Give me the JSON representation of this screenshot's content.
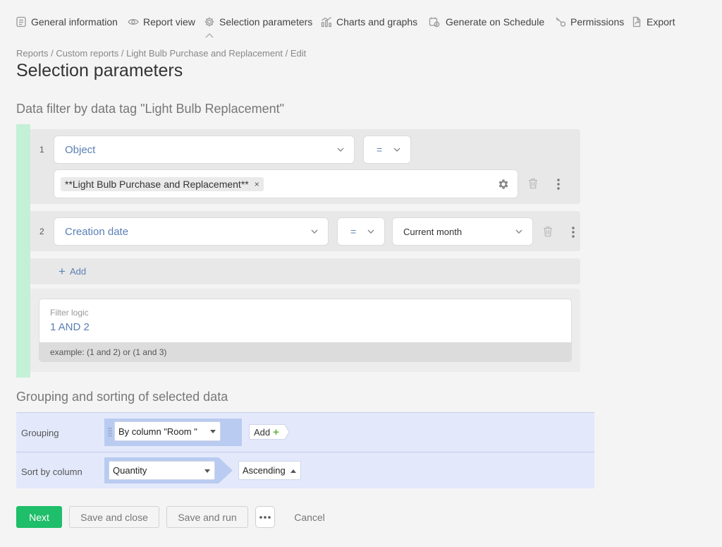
{
  "tabs": [
    {
      "label": "General information",
      "icon": "document-icon"
    },
    {
      "label": "Report view",
      "icon": "eye-icon"
    },
    {
      "label": "Selection parameters",
      "icon": "gear-icon",
      "active": true
    },
    {
      "label": "Charts and graphs",
      "icon": "chart-icon"
    },
    {
      "label": "Generate on Schedule",
      "icon": "calendar-clock-icon"
    },
    {
      "label": "Permissions",
      "icon": "key-icon"
    },
    {
      "label": "Export",
      "icon": "export-icon"
    }
  ],
  "breadcrumb": [
    "Reports",
    "Custom reports",
    "Light Bulb Purchase and Replacement",
    "Edit"
  ],
  "breadcrumb_sep": " / ",
  "page_title": "Selection parameters",
  "filter_section": {
    "title": "Data filter by data tag \"Light Bulb Replacement\"",
    "rows": [
      {
        "num": "1",
        "field": "Object",
        "operator": "=",
        "tag": "**Light Bulb Purchase and Replacement**",
        "tag_remove": "×"
      },
      {
        "num": "2",
        "field": "Creation date",
        "operator": "=",
        "value": "Current month"
      }
    ],
    "add_label": "Add",
    "logic": {
      "label": "Filter logic",
      "value": "1 AND 2",
      "hint": "example: (1 and 2) or (1 and 3)"
    }
  },
  "grouping_section": {
    "title": "Grouping and sorting of selected data",
    "grouping_label": "Grouping",
    "grouping_value": "By column \"Room \"",
    "add_label": "Add",
    "add_plus": "+",
    "sort_label": "Sort by column",
    "sort_column": "Quantity",
    "sort_order": "Ascending"
  },
  "actions": {
    "next": "Next",
    "save_close": "Save and close",
    "save_run": "Save and run",
    "cancel": "Cancel"
  },
  "colors": {
    "primary": "#1fbe6a",
    "accent_link": "#5b7fb5",
    "filter_bar": "#c3f0d7",
    "grouping_bg": "#e3e9fb"
  }
}
